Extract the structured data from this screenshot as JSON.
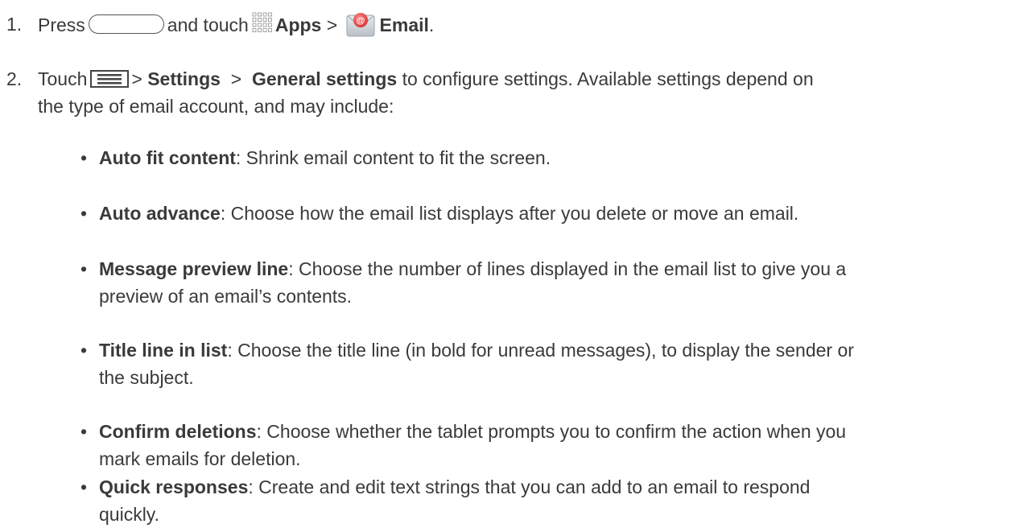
{
  "step1": {
    "num": "1.",
    "press": "Press",
    "and_touch": "and touch",
    "apps": "Apps",
    "sep": ">",
    "email": "Email",
    "end": "."
  },
  "step2": {
    "num": "2.",
    "touch": "Touch",
    "sep1": ">",
    "settings": "Settings",
    "sep2": ">",
    "general": "General settings",
    "rest_line1": "to configure settings. Available settings depend on",
    "line2": "the type of email account, and may include:"
  },
  "settings_list": [
    {
      "name": "Auto fit content",
      "l1": ": Shrink email content to fit the screen.",
      "l2": ""
    },
    {
      "name": "Auto advance",
      "l1": ": Choose how the email list displays after you delete or move an email.",
      "l2": ""
    },
    {
      "name": "Message preview line",
      "l1": ": Choose the number of lines displayed in the email list to give you a",
      "l2": "preview of an email’s contents."
    },
    {
      "name": "Title line in list",
      "l1": ": Choose the title line (in bold for unread messages), to display the sender or",
      "l2": "the subject."
    },
    {
      "name": "Confirm deletions",
      "l1": ": Choose whether the tablet prompts you to confirm the action when you",
      "l2": "mark emails for deletion."
    },
    {
      "name": "Quick responses",
      "l1": ": Create and edit text strings that you can add to an email to respond",
      "l2": "quickly."
    }
  ],
  "bullet": "•",
  "icons": {
    "home_key": "home-key-icon",
    "apps": "apps-grid-icon",
    "email": "email-app-icon",
    "menu": "menu-key-icon"
  },
  "colors": {
    "text": "#3a3a3a",
    "email_icon": "#e94f4f"
  }
}
